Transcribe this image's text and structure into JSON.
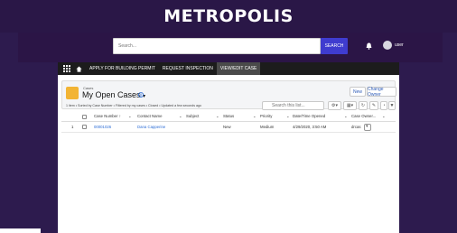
{
  "brand": {
    "title": "METROPOLIS"
  },
  "header": {
    "search_placeholder": "Search...",
    "search_button": "SEARCH",
    "user_name": "user"
  },
  "nav": {
    "items": [
      {
        "label": "APPLY FOR BUILDING PERMIT"
      },
      {
        "label": "REQUEST INSPECTION"
      },
      {
        "label": "VIEW/EDIT CASE"
      }
    ]
  },
  "list": {
    "breadcrumb": "Cases",
    "title": "My Open Cases",
    "meta": "1 item • Sorted by Case Number • Filtered by my cases • Closed • Updated a few seconds ago",
    "buttons": {
      "new": "New",
      "change_owner": "Change Owner"
    },
    "search_placeholder": "Search this list...",
    "columns": [
      {
        "label": "Case Number ↑"
      },
      {
        "label": "Contact Name"
      },
      {
        "label": "Subject"
      },
      {
        "label": "Status"
      },
      {
        "label": "Priority"
      },
      {
        "label": "Date/Time Opened"
      },
      {
        "label": "Case Owner..."
      }
    ],
    "rows": [
      {
        "num": "1",
        "case_number": "00001026",
        "contact_name": "Dana Capperine",
        "subject": "",
        "status": "New",
        "priority": "Medium",
        "opened": "4/29/2020, 3:50 AM",
        "owner": "drcas"
      }
    ]
  },
  "colors": {
    "background": "#2d1b4e",
    "search_button": "#3f3ccf",
    "link": "#2e6ed6",
    "accent_icon": "#f2b434"
  }
}
